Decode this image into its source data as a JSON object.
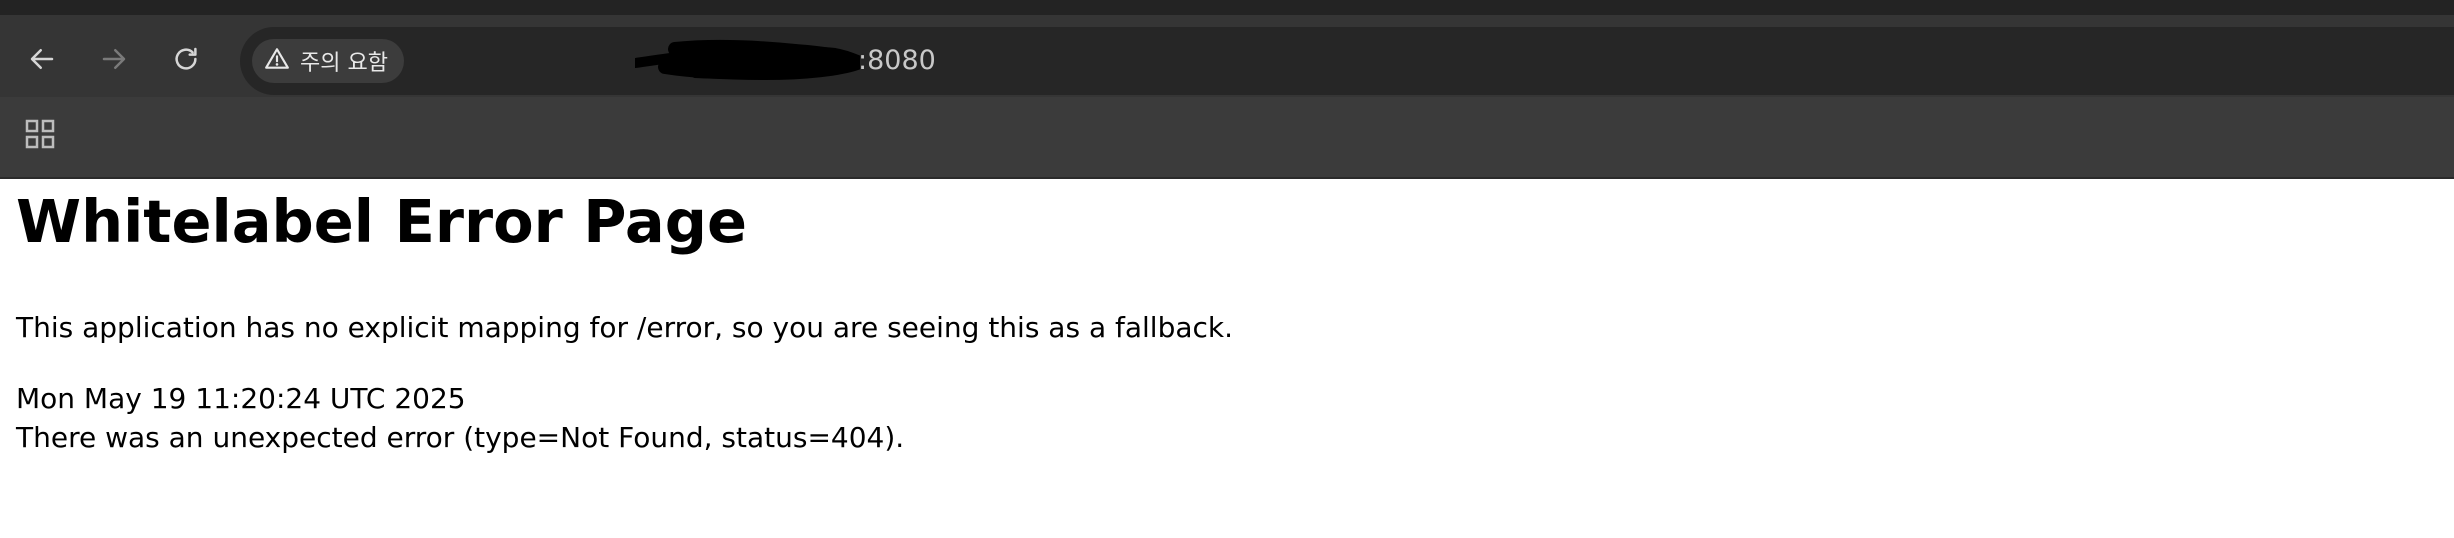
{
  "browser": {
    "security_chip": {
      "icon": "warning-triangle-icon",
      "label": "주의 요함"
    },
    "url_visible_suffix": ":8080",
    "nav_icons": [
      "back-arrow-icon",
      "forward-arrow-icon",
      "reload-icon"
    ],
    "bookmarks_icon": "apps-grid-icon",
    "colors": {
      "chrome_dark": "#232323",
      "toolbar": "#353535",
      "omnibox": "#262626",
      "chip": "#3c3c3c"
    }
  },
  "page": {
    "title": "Whitelabel Error Page",
    "explanation": "This application has no explicit mapping for /error, so you are seeing this as a fallback.",
    "timestamp": "Mon May 19 11:20:24 UTC 2025",
    "error_detail": "There was an unexpected error (type=Not Found, status=404)."
  }
}
